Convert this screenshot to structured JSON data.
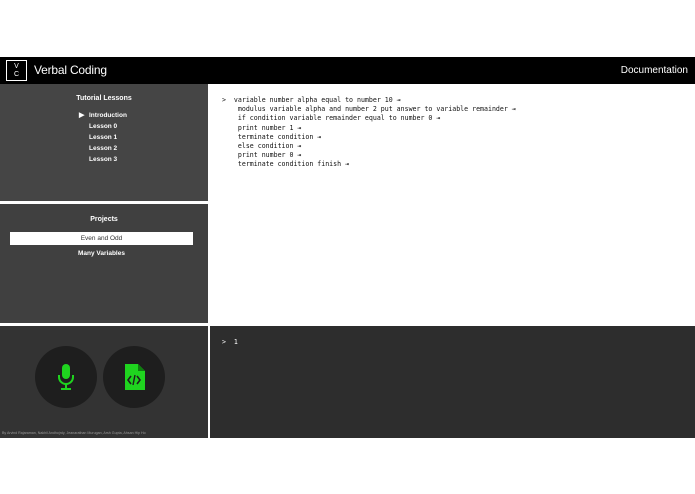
{
  "header": {
    "logo_top": "V",
    "logo_bottom": "C",
    "title": "Verbal Coding",
    "documentation": "Documentation"
  },
  "lessons": {
    "heading": "Tutorial Lessons",
    "items": [
      {
        "label": "Introduction",
        "active": true
      },
      {
        "label": "Lesson 0"
      },
      {
        "label": "Lesson 1"
      },
      {
        "label": "Lesson 2"
      },
      {
        "label": "Lesson 3"
      }
    ]
  },
  "projects": {
    "heading": "Projects",
    "items": [
      {
        "label": "Even and Odd",
        "selected": true
      },
      {
        "label": "Many Variables"
      }
    ]
  },
  "editor": {
    "code": ">  variable number alpha equal to number 10 ⇥\n    modulus variable alpha and number 2 put answer to variable remainder ⇥\n    if condition variable remainder equal to number 0 ⇥\n    print number 1 ⇥\n    terminate condition ⇥\n    else condition ⇥\n    print number 0 ⇥\n    terminate condition finish ⇥"
  },
  "output": {
    "text": ">  1"
  },
  "controls": {
    "mic_icon": "microphone-icon",
    "code_icon": "code-file-icon",
    "accent": "#1fd41f",
    "credits": "By Arvind Rajaraman, Nakhil Andhojrdy, Jeanarathan Murugan, Arsh Gupta, Ahsan Hip Ho"
  }
}
